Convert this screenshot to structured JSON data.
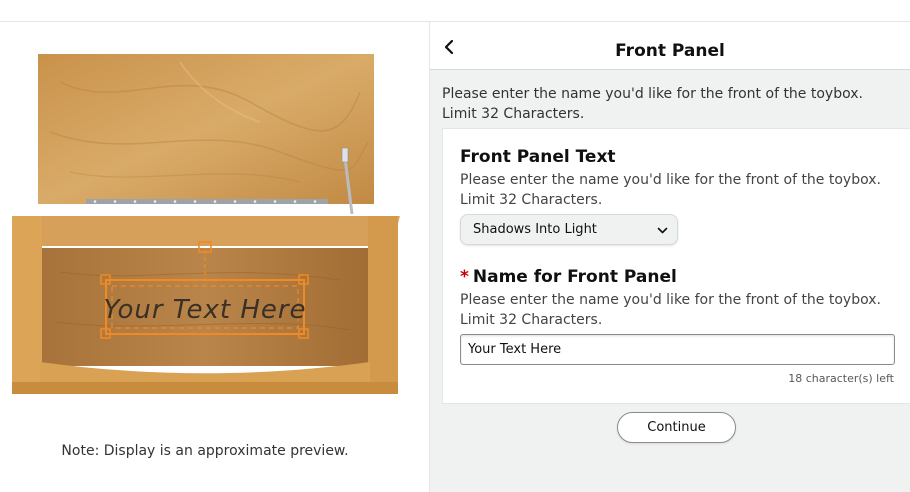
{
  "preview": {
    "engraving_text": "Your Text Here",
    "note": "Note: Display is an approximate preview.",
    "colors": {
      "wood_light": "#d9a55d",
      "wood_mid": "#c48a3f",
      "wood_dark": "#9c6a2a",
      "engraving_frame": "#f08a24",
      "engraving_text": "#3b3026"
    }
  },
  "panel": {
    "title": "Front Panel",
    "back_icon": "chevron-left-icon",
    "intro": "Please enter the name you'd like for the front of the toybox. Limit 32 Characters."
  },
  "font_field": {
    "title": "Front Panel Text",
    "description": "Please enter the name you'd like for the front of the toybox. Limit 32 Characters.",
    "selected_font": "Shadows Into Light",
    "dropdown_icon": "chevron-down-icon"
  },
  "name_field": {
    "required_marker": "*",
    "title": "Name for Front Panel",
    "description": "Please enter the name you'd like for the front of the toybox. Limit 32 Characters.",
    "value": "Your Text Here",
    "chars_left": "18 character(s) left"
  },
  "actions": {
    "continue_label": "Continue"
  },
  "colors": {
    "required": "#c40000",
    "panel_bg": "#f0f2f2",
    "border": "#d5d9d9"
  }
}
